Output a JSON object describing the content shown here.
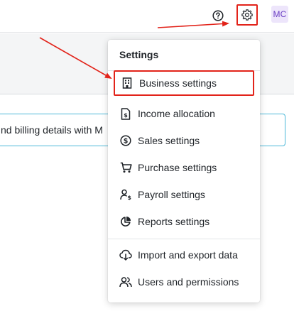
{
  "topbar": {
    "help_icon": "help-circle-icon",
    "settings_icon": "gear-icon",
    "avatar_initials": "MC"
  },
  "banner": {
    "text": "nd billing details with M"
  },
  "settings_menu": {
    "title": "Settings",
    "items": [
      {
        "label": "Business settings",
        "icon": "building-icon"
      },
      {
        "label": "Income allocation",
        "icon": "document-dollar-icon"
      },
      {
        "label": "Sales settings",
        "icon": "dollar-circle-icon"
      },
      {
        "label": "Purchase settings",
        "icon": "shopping-cart-icon"
      },
      {
        "label": "Payroll settings",
        "icon": "user-dollar-icon"
      },
      {
        "label": "Reports settings",
        "icon": "pie-chart-icon"
      },
      {
        "label": "Import and export data",
        "icon": "cloud-transfer-icon"
      },
      {
        "label": "Users and permissions",
        "icon": "users-icon"
      }
    ]
  },
  "annotation": {
    "highlight_color": "#e2231a"
  }
}
